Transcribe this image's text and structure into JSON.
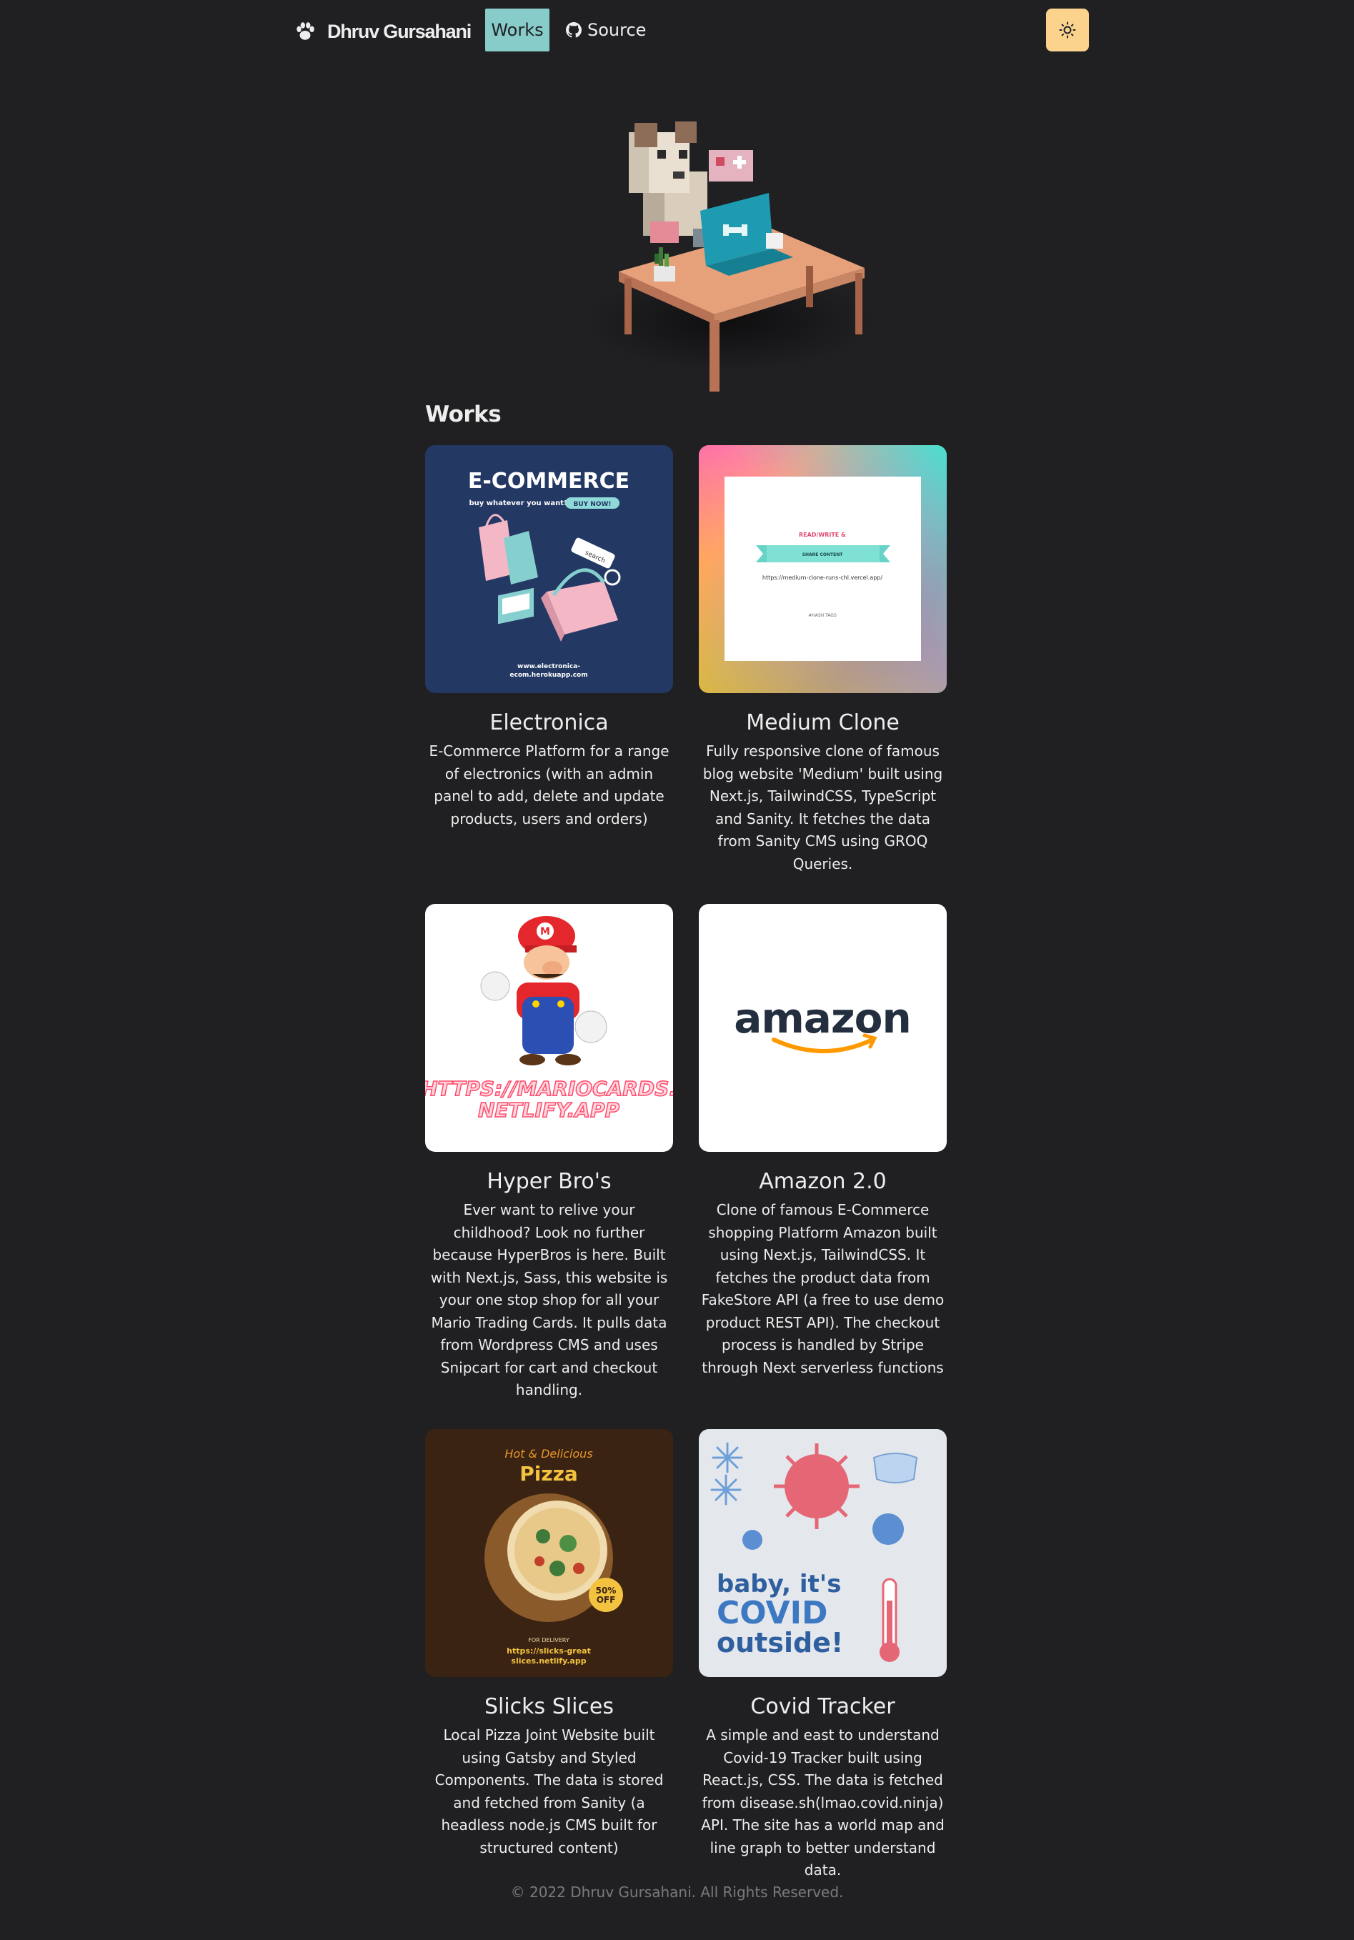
{
  "nav": {
    "brand": "Dhruv Gursahani",
    "works_label": "Works",
    "source_label": "Source",
    "brand_icon": "paw-icon",
    "source_icon": "github-icon",
    "theme_icon": "sun-icon"
  },
  "colors": {
    "background": "#202023",
    "accent_teal": "#88ccca",
    "theme_button": "#fbd38d"
  },
  "section": {
    "title": "Works"
  },
  "works": [
    {
      "title": "Electronica",
      "description": "E-Commerce Platform for a range of electronics (with an admin panel to add, delete and update products, users and orders)",
      "thumb": {
        "heading": "E-COMMERCE",
        "tagline": "buy whatever you want!",
        "button": "BUY NOW!",
        "search": "search",
        "url_line1": "www.electronica-",
        "url_line2": "ecom.herokuapp.com"
      }
    },
    {
      "title": "Medium Clone",
      "description": "Fully responsive clone of famous blog website 'Medium' built using Next.js, TailwindCSS, TypeScript and Sanity. It fetches the data from Sanity CMS using GROQ Queries.",
      "thumb": {
        "line1": "READ/WRITE &",
        "banner": "SHARE CONTENT",
        "url": "https://medium-clone-runs-chl.vercel.app/",
        "tags": "#HASH TAGS"
      }
    },
    {
      "title": "Hyper Bro's",
      "description": "Ever want to relive your childhood? Look no further because HyperBros is here. Built with Next.js, Sass, this website is your one stop shop for all your Mario Trading Cards. It pulls data from Wordpress CMS and uses Snipcart for cart and checkout handling.",
      "thumb": {
        "url_line1": "HTTPS://MARIOCARDS.",
        "url_line2": "NETLIFY.APP",
        "cap_letter": "M"
      }
    },
    {
      "title": "Amazon 2.0",
      "description": "Clone of famous E-Commerce shopping Platform Amazon built using Next.js, TailwindCSS. It fetches the product data from FakeStore API (a free to use demo product REST API). The checkout process is handled by Stripe through Next serverless functions",
      "thumb": {
        "logo": "amazon"
      }
    },
    {
      "title": "Slicks Slices",
      "description": "Local Pizza Joint Website built using Gatsby and Styled Components. The data is stored and fetched from Sanity (a headless node.js CMS built for structured content)",
      "thumb": {
        "script": "Hot & Delicious",
        "heading": "Pizza",
        "badge_line1": "50%",
        "badge_line2": "OFF",
        "delivery": "FOR DELIVERY",
        "url_line1": "https://slicks-great",
        "url_line2": "slices.netlify.app"
      }
    },
    {
      "title": "Covid Tracker",
      "description": "A simple and east to understand Covid-19 Tracker built using React.js, CSS. The data is fetched from disease.sh(lmao.covid.ninja) API. The site has a world map and line graph to better understand data.",
      "thumb": {
        "line1": "baby, it's",
        "line2": "COVID",
        "line3": "outside!"
      }
    }
  ],
  "footer": {
    "text": "© 2022 Dhruv Gursahani. All Rights Reserved."
  }
}
